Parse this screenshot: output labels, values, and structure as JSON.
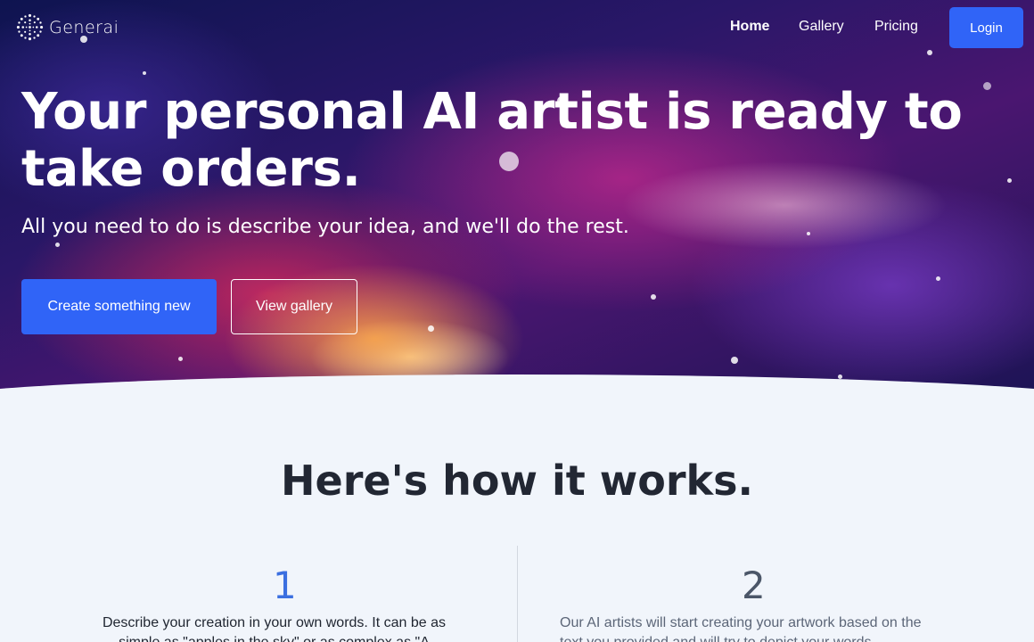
{
  "nav": {
    "brand": "Generai",
    "links": [
      {
        "label": "Home",
        "active": true
      },
      {
        "label": "Gallery",
        "active": false
      },
      {
        "label": "Pricing",
        "active": false
      }
    ],
    "login_label": "Login"
  },
  "hero": {
    "headline": "Your personal AI artist is ready to take orders.",
    "subhead": "All you need to do is describe your idea, and we'll do the rest.",
    "primary_cta": "Create something new",
    "secondary_cta": "View gallery"
  },
  "how_it_works": {
    "title": "Here's how it works.",
    "steps": [
      {
        "number": "1",
        "text": "Describe your creation in your own words. It can be as simple as \"apples in the sky\" or as complex as \"A"
      },
      {
        "number": "2",
        "text": "Our AI artists will start creating your artwork based on the text you provided and will try to depict your words"
      }
    ]
  },
  "colors": {
    "accent": "#3064f7",
    "step1": "#3b6fe0",
    "step2": "#4b5668",
    "page_bg": "#f1f5fb"
  }
}
